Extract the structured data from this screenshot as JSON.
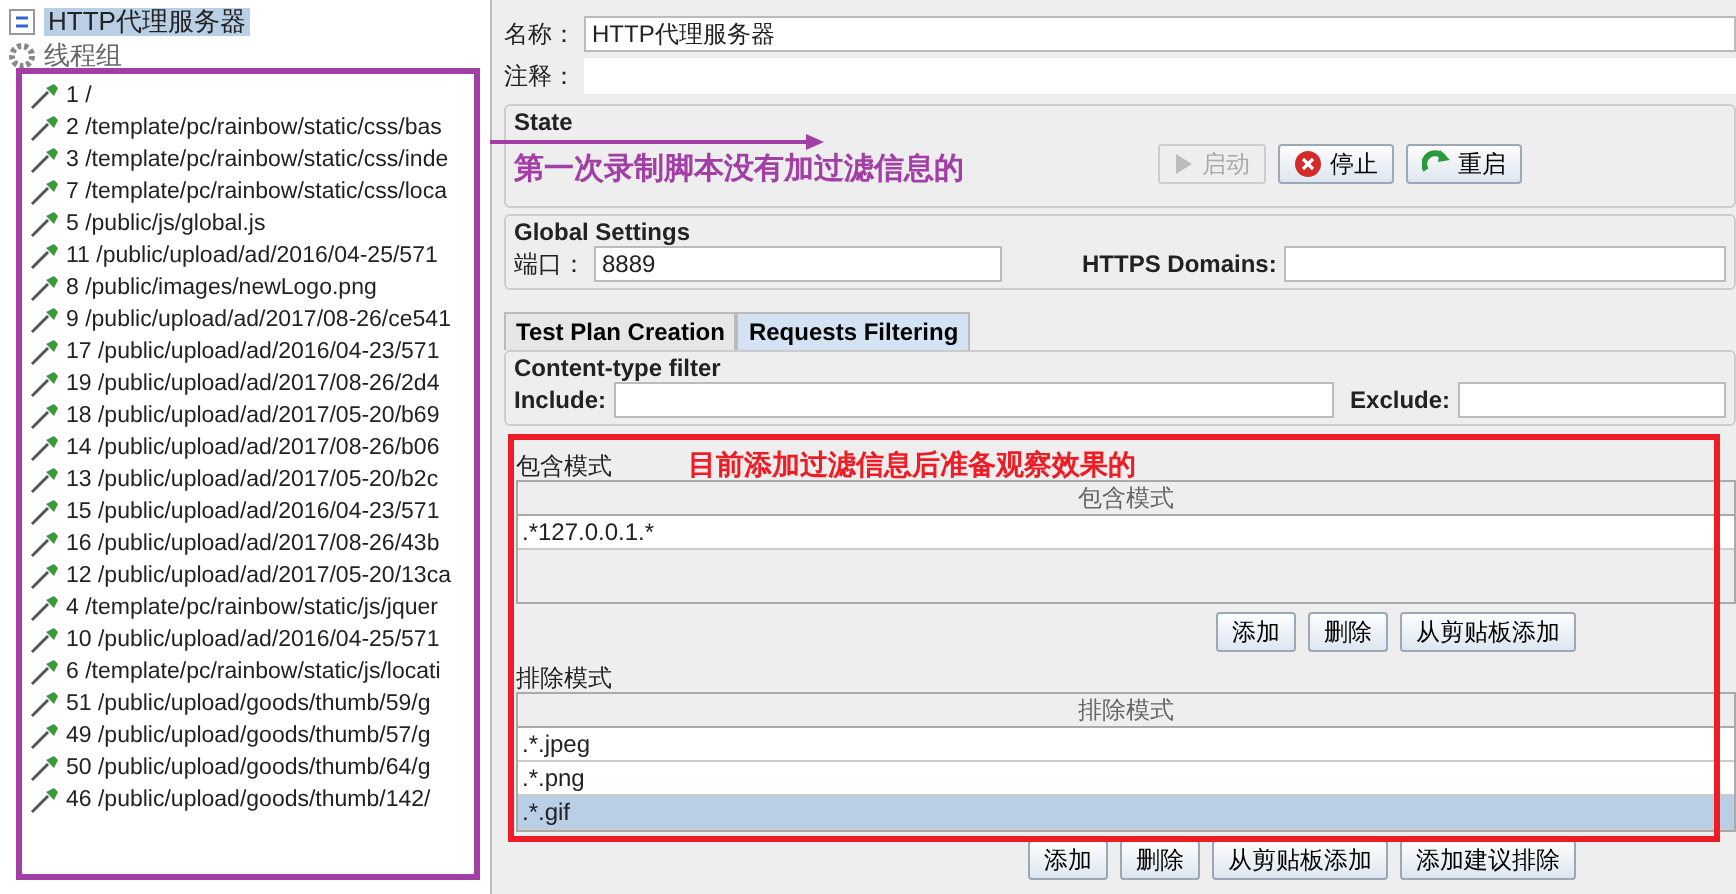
{
  "tree": {
    "root": {
      "label": "HTTP代理服务器",
      "selected": true
    },
    "group": {
      "label": "线程组"
    },
    "samplers": [
      {
        "label": "1 /"
      },
      {
        "label": "2 /template/pc/rainbow/static/css/bas"
      },
      {
        "label": "3 /template/pc/rainbow/static/css/inde"
      },
      {
        "label": "7 /template/pc/rainbow/static/css/loca"
      },
      {
        "label": "5 /public/js/global.js"
      },
      {
        "label": "11 /public/upload/ad/2016/04-25/571"
      },
      {
        "label": "8 /public/images/newLogo.png"
      },
      {
        "label": "9 /public/upload/ad/2017/08-26/ce541"
      },
      {
        "label": "17 /public/upload/ad/2016/04-23/571"
      },
      {
        "label": "19 /public/upload/ad/2017/08-26/2d4"
      },
      {
        "label": "18 /public/upload/ad/2017/05-20/b69"
      },
      {
        "label": "14 /public/upload/ad/2017/08-26/b06"
      },
      {
        "label": "13 /public/upload/ad/2017/05-20/b2c"
      },
      {
        "label": "15 /public/upload/ad/2016/04-23/571"
      },
      {
        "label": "16 /public/upload/ad/2017/08-26/43b"
      },
      {
        "label": "12 /public/upload/ad/2017/05-20/13ca"
      },
      {
        "label": "4 /template/pc/rainbow/static/js/jquer"
      },
      {
        "label": "10 /public/upload/ad/2016/04-25/571"
      },
      {
        "label": "6 /template/pc/rainbow/static/js/locati"
      },
      {
        "label": "51 /public/upload/goods/thumb/59/g"
      },
      {
        "label": "49 /public/upload/goods/thumb/57/g"
      },
      {
        "label": "50 /public/upload/goods/thumb/64/g"
      },
      {
        "label": "46 /public/upload/goods/thumb/142/"
      }
    ]
  },
  "form": {
    "name_label": "名称：",
    "name_value": "HTTP代理服务器",
    "comment_label": "注释："
  },
  "state": {
    "title": "State",
    "buttons": [
      {
        "label": "启动",
        "kind": "start",
        "disabled": true
      },
      {
        "label": "停止",
        "kind": "stop",
        "disabled": false
      },
      {
        "label": "重启",
        "kind": "restart",
        "disabled": false
      }
    ]
  },
  "global_settings": {
    "title": "Global Settings",
    "port_label": "端口：",
    "port_value": "8889",
    "https_label": "HTTPS Domains:"
  },
  "tabs": [
    {
      "label": "Test Plan Creation",
      "selected": false
    },
    {
      "label": "Requests Filtering",
      "selected": true
    }
  ],
  "content_type_filter": {
    "title": "Content-type filter",
    "include_label": "Include:",
    "exclude_label": "Exclude:"
  },
  "include_patterns": {
    "title": "包含模式",
    "column": "包含模式",
    "rows": [
      {
        "value": ".*127.0.0.1.*",
        "selected": false
      }
    ],
    "buttons": [
      "添加",
      "删除",
      "从剪贴板添加"
    ]
  },
  "exclude_patterns": {
    "title": "排除模式",
    "column": "排除模式",
    "rows": [
      {
        "value": ".*.jpeg",
        "selected": false
      },
      {
        "value": ".*.png",
        "selected": false
      },
      {
        "value": ".*.gif",
        "selected": true
      }
    ],
    "buttons": [
      "添加",
      "删除",
      "从剪贴板添加",
      "添加建议排除"
    ]
  },
  "annotations": [
    {
      "kind": "list-frame",
      "color": "#a23fa6"
    },
    {
      "kind": "arrow-note",
      "text": "第一次录制脚本没有加过滤信息的",
      "color": "#a23fa6"
    },
    {
      "kind": "box-note",
      "text": "目前添加过滤信息后准备观察效果的",
      "color": "#ee1c24"
    }
  ]
}
